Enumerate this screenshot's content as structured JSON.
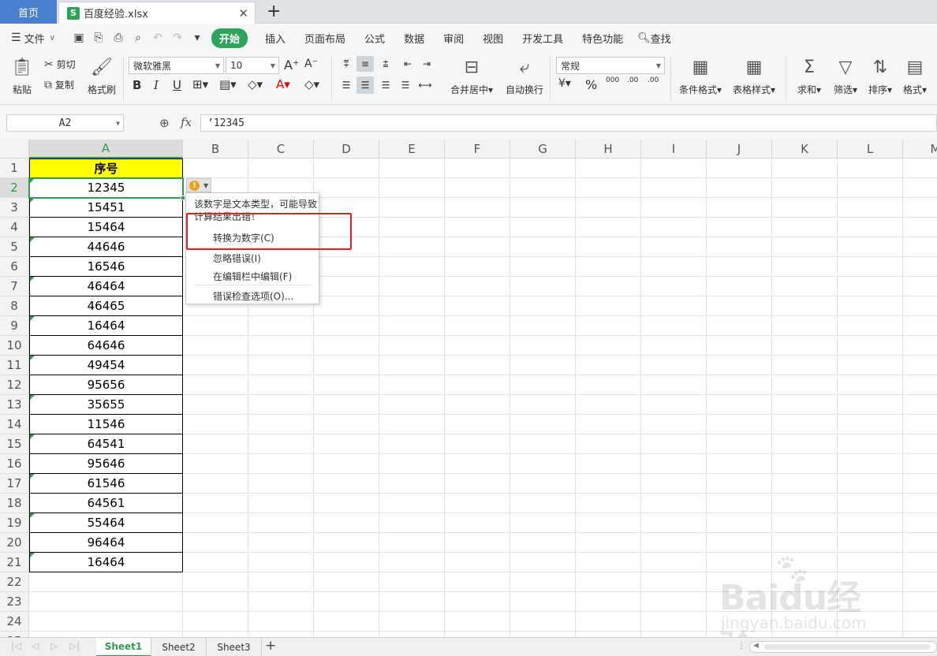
{
  "tabs": {
    "home": "首页",
    "file": "百度经验.xlsx",
    "file_icon": "S"
  },
  "menu": {
    "file_label": "文件",
    "tabs": [
      "开始",
      "插入",
      "页面布局",
      "公式",
      "数据",
      "审阅",
      "视图",
      "开发工具",
      "特色功能"
    ],
    "search_label": "查找"
  },
  "ribbon": {
    "paste": "粘贴",
    "cut": "剪切",
    "copy": "复制",
    "format_painter": "格式刷",
    "font_name": "微软雅黑",
    "font_size": "10",
    "merge": "合并居中",
    "wrap": "自动换行",
    "number_format": "常规",
    "cond_format": "条件格式",
    "table_style": "表格样式",
    "sum": "求和",
    "filter": "筛选",
    "sort": "排序",
    "format": "格式"
  },
  "formula_bar": {
    "cell_ref": "A2",
    "fx": "fx",
    "content": "’12345"
  },
  "columns": [
    "A",
    "B",
    "C",
    "D",
    "E",
    "F",
    "G",
    "H",
    "I",
    "J",
    "K",
    "L",
    "M"
  ],
  "rows": [
    "1",
    "2",
    "3",
    "4",
    "5",
    "6",
    "7",
    "8",
    "9",
    "10",
    "11",
    "12",
    "13",
    "14",
    "15",
    "16",
    "17",
    "18",
    "19",
    "20",
    "21",
    "22",
    "23",
    "24",
    "25"
  ],
  "column_a": {
    "header": "序号",
    "values": [
      "12345",
      "15451",
      "15464",
      "44646",
      "16546",
      "46464",
      "46465",
      "16464",
      "64646",
      "49454",
      "95656",
      "35655",
      "11546",
      "64541",
      "95646",
      "61546",
      "64561",
      "55464",
      "96464",
      "16464"
    ]
  },
  "error_popup": {
    "message": "该数字是文本类型，可能导致计算结果出错！",
    "items": [
      "转换为数字(C)",
      "忽略错误(I)",
      "在编辑栏中编辑(F)",
      "错误检查选项(O)..."
    ]
  },
  "sheets": [
    "Sheet1",
    "Sheet2",
    "Sheet3"
  ],
  "watermark": {
    "brand": "Baidu经验",
    "site": "jingyan.baidu.com"
  },
  "colors": {
    "accent": "#2ea35a",
    "header_fill": "#ffff00",
    "highlight": "#e02020"
  }
}
